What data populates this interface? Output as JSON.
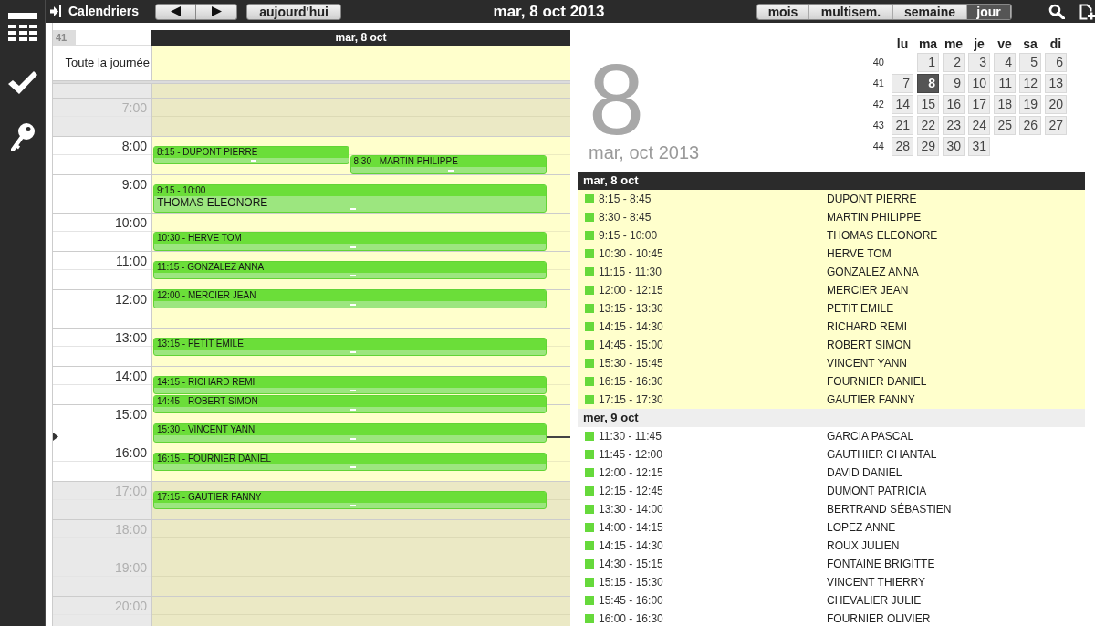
{
  "toolbar": {
    "calendars_button": "Calendriers",
    "today_button": "aujourd'hui",
    "title": "mar, 8 oct 2013",
    "views": [
      {
        "label": "mois",
        "selected": false
      },
      {
        "label": "multisem.",
        "selected": false
      },
      {
        "label": "semaine",
        "selected": false
      },
      {
        "label": "jour",
        "selected": true
      }
    ]
  },
  "day_view": {
    "week_number": "41",
    "day_header": "mar, 8 oct",
    "all_day_label": "Toute la journée",
    "hours": [
      {
        "label": "7:00",
        "working": false
      },
      {
        "label": "8:00",
        "working": true
      },
      {
        "label": "9:00",
        "working": true
      },
      {
        "label": "10:00",
        "working": true
      },
      {
        "label": "11:00",
        "working": true
      },
      {
        "label": "12:00",
        "working": true
      },
      {
        "label": "13:00",
        "working": true
      },
      {
        "label": "14:00",
        "working": true
      },
      {
        "label": "15:00",
        "working": true
      },
      {
        "label": "16:00",
        "working": true
      },
      {
        "label": "17:00",
        "working": false
      },
      {
        "label": "18:00",
        "working": false
      },
      {
        "label": "19:00",
        "working": false
      },
      {
        "label": "20:00",
        "working": false
      }
    ],
    "events": [
      {
        "kind": "compact",
        "label": "8:15 - DUPONT PIERRE"
      },
      {
        "kind": "compact",
        "label": "8:30 - MARTIN PHILIPPE"
      },
      {
        "kind": "expanded",
        "time": "9:15 - 10:00",
        "name": "THOMAS ELEONORE"
      },
      {
        "kind": "compact",
        "label": "10:30 - HERVE TOM"
      },
      {
        "kind": "compact",
        "label": "11:15 - GONZALEZ ANNA"
      },
      {
        "kind": "compact",
        "label": "12:00 - MERCIER JEAN"
      },
      {
        "kind": "compact",
        "label": "13:15 - PETIT EMILE"
      },
      {
        "kind": "compact",
        "label": "14:15 - RICHARD REMI"
      },
      {
        "kind": "compact",
        "label": "14:45 - ROBERT SIMON"
      },
      {
        "kind": "compact",
        "label": "15:30 - VINCENT YANN"
      },
      {
        "kind": "compact",
        "label": "16:15 - FOURNIER DANIEL"
      },
      {
        "kind": "compact",
        "label": "17:15 - GAUTIER FANNY"
      }
    ]
  },
  "date_panel": {
    "day": "8",
    "month_year": "mar, oct 2013"
  },
  "mini_calendar": {
    "weekdays": [
      "lu",
      "ma",
      "me",
      "je",
      "ve",
      "sa",
      "di"
    ],
    "weeks": [
      {
        "number": "40",
        "days": [
          {
            "label": "1",
            "selected": false
          },
          {
            "label": "2",
            "selected": false
          },
          {
            "label": "3",
            "selected": false
          },
          {
            "label": "4",
            "selected": false
          },
          {
            "label": "5",
            "selected": false
          },
          {
            "label": "6",
            "selected": false
          }
        ]
      },
      {
        "number": "41",
        "days": [
          {
            "label": "7",
            "selected": false
          },
          {
            "label": "8",
            "selected": true
          },
          {
            "label": "9",
            "selected": false
          },
          {
            "label": "10",
            "selected": false
          },
          {
            "label": "11",
            "selected": false
          },
          {
            "label": "12",
            "selected": false
          },
          {
            "label": "13",
            "selected": false
          }
        ]
      },
      {
        "number": "42",
        "days": [
          {
            "label": "14",
            "selected": false
          },
          {
            "label": "15",
            "selected": false
          },
          {
            "label": "16",
            "selected": false
          },
          {
            "label": "17",
            "selected": false
          },
          {
            "label": "18",
            "selected": false
          },
          {
            "label": "19",
            "selected": false
          },
          {
            "label": "20",
            "selected": false
          }
        ]
      },
      {
        "number": "43",
        "days": [
          {
            "label": "21",
            "selected": false
          },
          {
            "label": "22",
            "selected": false
          },
          {
            "label": "23",
            "selected": false
          },
          {
            "label": "24",
            "selected": false
          },
          {
            "label": "25",
            "selected": false
          },
          {
            "label": "26",
            "selected": false
          },
          {
            "label": "27",
            "selected": false
          }
        ]
      },
      {
        "number": "44",
        "days": [
          {
            "label": "28",
            "selected": false
          },
          {
            "label": "29",
            "selected": false
          },
          {
            "label": "30",
            "selected": false
          },
          {
            "label": "31",
            "selected": false
          }
        ]
      }
    ]
  },
  "agenda": {
    "groups": [
      {
        "header": "mar, 8 oct",
        "today": true,
        "entries": [
          {
            "time": "8:15 - 8:45",
            "name": "DUPONT PIERRE"
          },
          {
            "time": "8:30 - 8:45",
            "name": "MARTIN PHILIPPE"
          },
          {
            "time": "9:15 - 10:00",
            "name": "THOMAS ELEONORE"
          },
          {
            "time": "10:30 - 10:45",
            "name": "HERVE TOM"
          },
          {
            "time": "11:15 - 11:30",
            "name": "GONZALEZ ANNA"
          },
          {
            "time": "12:00 - 12:15",
            "name": "MERCIER JEAN"
          },
          {
            "time": "13:15 - 13:30",
            "name": "PETIT EMILE"
          },
          {
            "time": "14:15 - 14:30",
            "name": "RICHARD REMI"
          },
          {
            "time": "14:45 - 15:00",
            "name": "ROBERT SIMON"
          },
          {
            "time": "15:30 - 15:45",
            "name": "VINCENT YANN"
          },
          {
            "time": "16:15 - 16:30",
            "name": "FOURNIER DANIEL"
          },
          {
            "time": "17:15 - 17:30",
            "name": "GAUTIER FANNY"
          }
        ]
      },
      {
        "header": "mer, 9 oct",
        "today": false,
        "entries": [
          {
            "time": "11:30 - 11:45",
            "name": "GARCIA PASCAL"
          },
          {
            "time": "11:45 - 12:00",
            "name": "GAUTHIER CHANTAL"
          },
          {
            "time": "12:00 - 12:15",
            "name": "DAVID DANIEL"
          },
          {
            "time": "12:15 - 12:45",
            "name": "DUMONT PATRICIA"
          },
          {
            "time": "13:30 - 14:00",
            "name": "BERTRAND SÉBASTIEN"
          },
          {
            "time": "14:00 - 14:15",
            "name": "LOPEZ ANNE"
          },
          {
            "time": "14:15 - 14:30",
            "name": "ROUX JULIEN"
          },
          {
            "time": "14:30 - 15:15",
            "name": "FONTAINE BRIGITTE"
          },
          {
            "time": "15:15 - 15:30",
            "name": "VINCENT THIERRY"
          },
          {
            "time": "15:45 - 16:00",
            "name": "CHEVALIER JULIE"
          },
          {
            "time": "16:00 - 16:30",
            "name": "FOURNIER OLIVIER"
          }
        ]
      }
    ]
  }
}
